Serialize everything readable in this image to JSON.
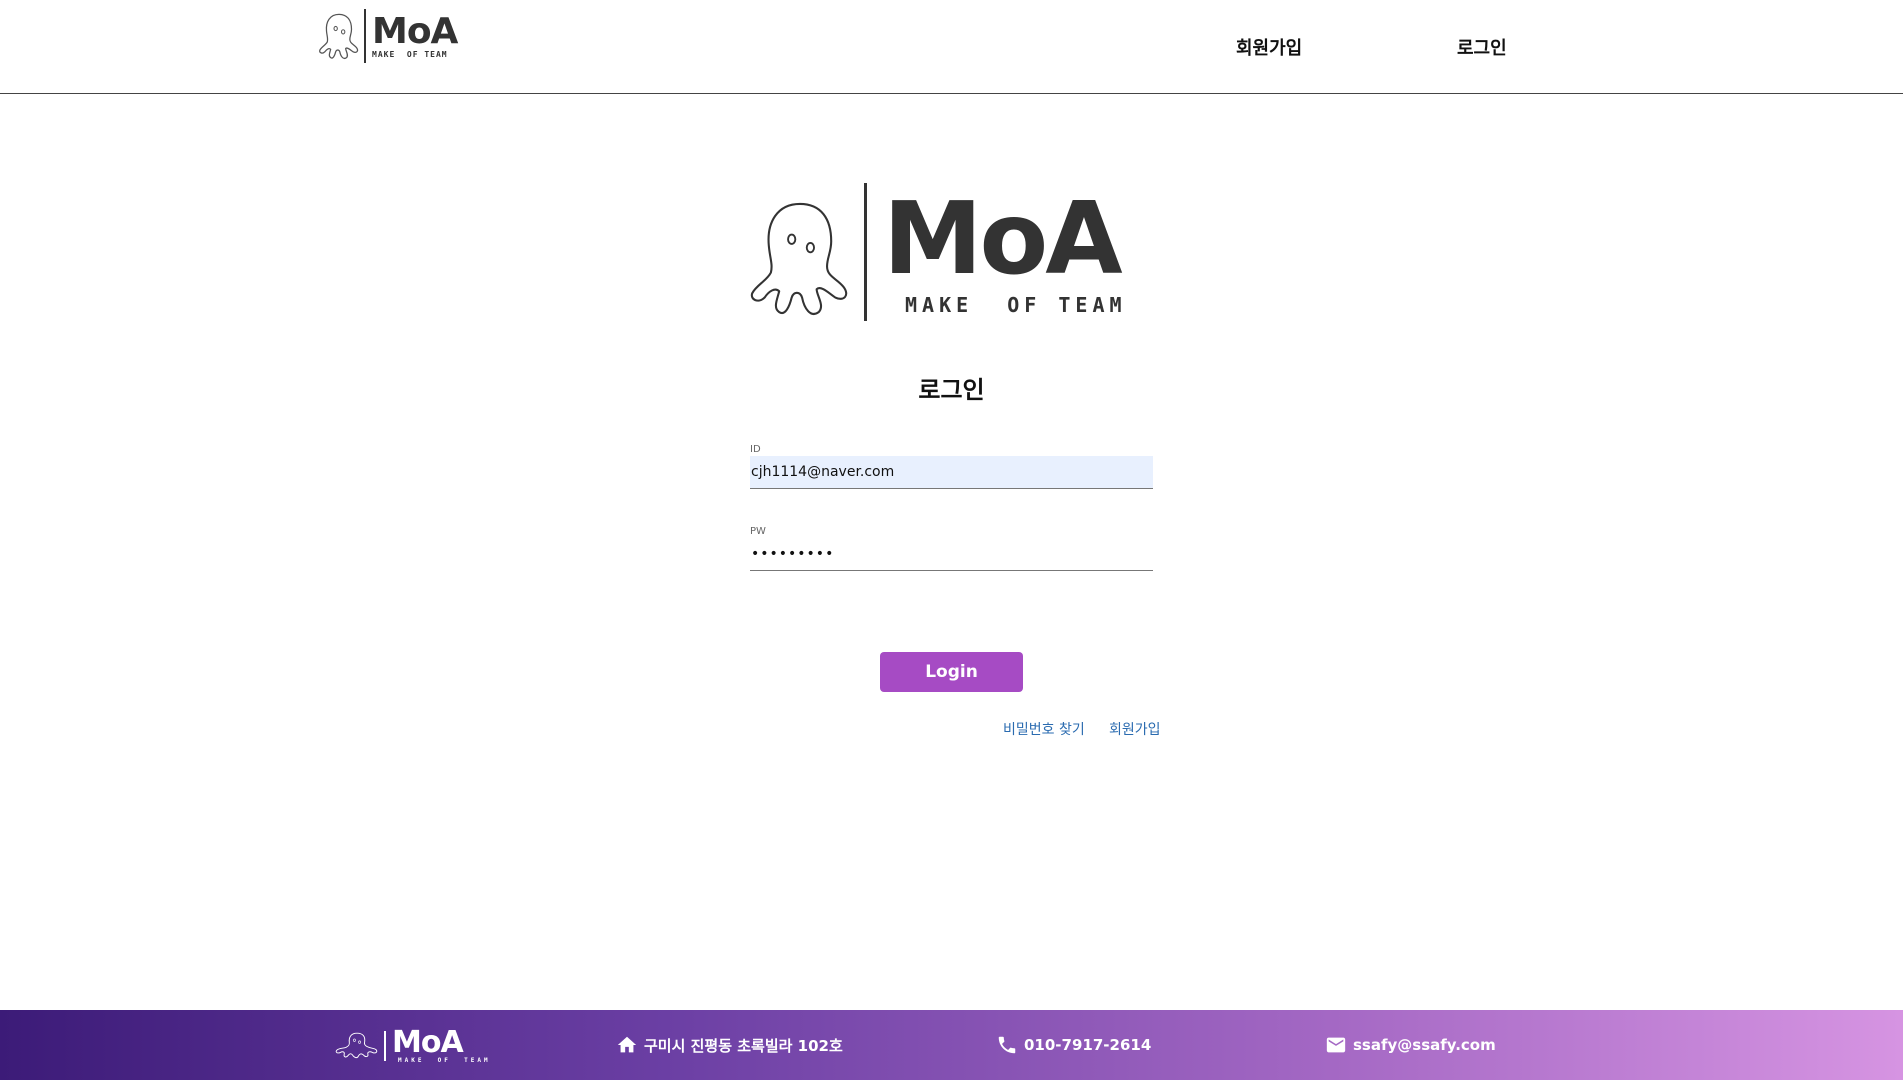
{
  "header": {
    "logo": {
      "name": "MoA",
      "tagline": "MAKE  OF TEAM"
    },
    "nav": {
      "signup": "회원가입",
      "login": "로그인"
    }
  },
  "main": {
    "logo": {
      "name": "MoA",
      "tagline": "MAKE  OF TEAM"
    },
    "title": "로그인",
    "id_field": {
      "label": "ID",
      "value": "cjh1114@naver.com"
    },
    "pw_field": {
      "label": "PW",
      "value": "•••••••••"
    },
    "login_button": "Login",
    "links": {
      "find_password": "비밀번호 찾기",
      "signup": "회원가입"
    }
  },
  "footer": {
    "logo": {
      "name": "MoA",
      "tagline": "MAKE  OF  TEAM"
    },
    "address": "구미시 진평동 초록빌라 102호",
    "phone": "010-7917-2614",
    "email": "ssafy@ssafy.com",
    "icons": {
      "address": "home-icon",
      "phone": "phone-icon",
      "email": "mail-icon"
    }
  },
  "colors": {
    "accent": "#a64bc4",
    "link": "#2a6bb0",
    "footer_gradient_start": "#3c1b78",
    "footer_gradient_end": "#d694e2",
    "autofill_bg": "#e8f0fe"
  }
}
